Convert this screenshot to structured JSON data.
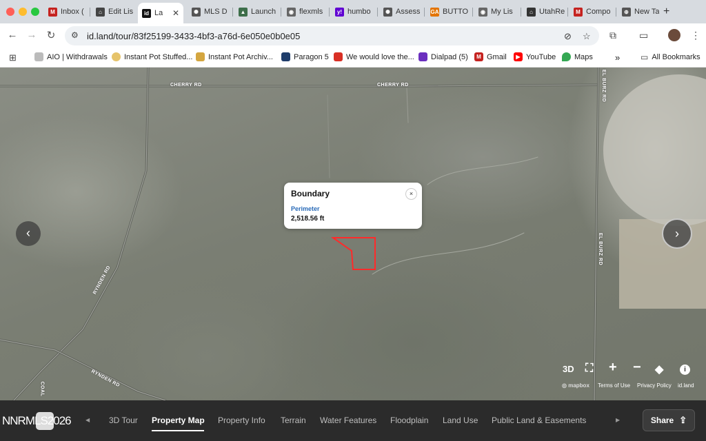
{
  "browser": {
    "tabs": [
      {
        "title": "Inbox (",
        "favicon": "gmail-icon",
        "color": "#c5221f",
        "glyph": "M"
      },
      {
        "title": "Edit Lis",
        "favicon": "house-icon",
        "color": "#444444",
        "glyph": "⌂"
      },
      {
        "title": "La",
        "favicon": "idland-icon",
        "color": "#111111",
        "glyph": "id",
        "active": true
      },
      {
        "title": "MLS D",
        "favicon": "chatgpt-icon",
        "color": "#555555",
        "glyph": "✺"
      },
      {
        "title": "Launch",
        "favicon": "image-icon",
        "color": "#3d6e4a",
        "glyph": "▲"
      },
      {
        "title": "flexmls",
        "favicon": "flex-icon",
        "color": "#666666",
        "glyph": "◉"
      },
      {
        "title": "humbo",
        "favicon": "yahoo-icon",
        "color": "#6001d2",
        "glyph": "y!"
      },
      {
        "title": "Assess",
        "favicon": "chatgpt-icon",
        "color": "#555555",
        "glyph": "✺"
      },
      {
        "title": "BUTTO",
        "favicon": "ga-icon",
        "color": "#e37400",
        "glyph": "GA"
      },
      {
        "title": "My Lis",
        "favicon": "flex-icon",
        "color": "#666666",
        "glyph": "◉"
      },
      {
        "title": "UtahRe",
        "favicon": "realtor-icon",
        "color": "#333333",
        "glyph": "⌂"
      },
      {
        "title": "Compo",
        "favicon": "gmail-icon",
        "color": "#c5221f",
        "glyph": "M"
      },
      {
        "title": "New Ta",
        "favicon": "globe-icon",
        "color": "#555555",
        "glyph": "⊕"
      }
    ],
    "new_tab": "+",
    "url": "id.land/tour/83f25199-3433-4bf3-a76d-6e050e0b0e05",
    "bookmarks": [
      {
        "label": "AIO | Withdrawals",
        "icon": "aio-icon",
        "color": "#bbbbbb"
      },
      {
        "label": "Instant Pot Stuffed...",
        "icon": "pot-icon",
        "color": "#e6c36a"
      },
      {
        "label": "Instant Pot Archiv...",
        "icon": "pot-icon",
        "color": "#d4a640"
      },
      {
        "label": "Paragon 5",
        "icon": "paragon-icon",
        "color": "#1f3d6b"
      },
      {
        "label": "We would love the...",
        "icon": "house-icon",
        "color": "#d93025"
      },
      {
        "label": "Dialpad (5)",
        "icon": "dialpad-icon",
        "color": "#6b2fbf"
      },
      {
        "label": "Gmail",
        "icon": "gmail-icon",
        "color": "#c5221f"
      },
      {
        "label": "YouTube",
        "icon": "youtube-icon",
        "color": "#ff0000"
      },
      {
        "label": "Maps",
        "icon": "maps-icon",
        "color": "#34a853"
      }
    ],
    "bookmarks_overflow": "»",
    "all_bookmarks": "All Bookmarks"
  },
  "map": {
    "roads": [
      {
        "name": "CHERRY RD"
      },
      {
        "name": "CHERRY RD"
      },
      {
        "name": "RYNDEN RD"
      },
      {
        "name": "RYNDEN RD"
      },
      {
        "name": "EL BURZ RD"
      },
      {
        "name": "EL BURZ RD"
      },
      {
        "name": "COAL"
      }
    ],
    "boundary_color": "#ff2a2a",
    "popup": {
      "title": "Boundary",
      "close": "×",
      "label": "Perimeter",
      "value": "2,518.56 ft"
    },
    "prev_arrow": "‹",
    "next_arrow": "›",
    "controls": {
      "three_d": "3D",
      "fullscreen": "⛶",
      "zoom_in": "+",
      "zoom_out": "−",
      "layers": "◆",
      "info": "i"
    },
    "attribution": {
      "mapbox": "mapbox",
      "terms": "Terms of Use",
      "privacy": "Privacy Policy",
      "idland": "id.land"
    }
  },
  "tour_nav": {
    "brand": "NNRMLS2026",
    "items": [
      {
        "label": "3D Tour",
        "active": false
      },
      {
        "label": "Property Map",
        "active": true
      },
      {
        "label": "Property Info",
        "active": false
      },
      {
        "label": "Terrain",
        "active": false
      },
      {
        "label": "Water Features",
        "active": false
      },
      {
        "label": "Floodplain",
        "active": false
      },
      {
        "label": "Land Use",
        "active": false
      },
      {
        "label": "Public Land & Easements",
        "active": false
      }
    ],
    "scroll_left": "◀",
    "scroll_right": "▶",
    "share_label": "Share"
  }
}
